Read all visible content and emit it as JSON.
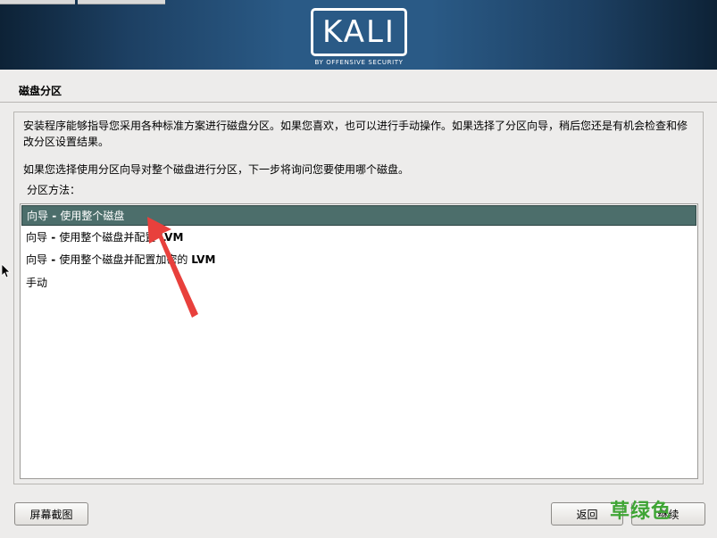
{
  "banner": {
    "logo_text": "KALI",
    "logo_subtext": "BY OFFENSIVE SECURITY"
  },
  "page": {
    "title": "磁盘分区",
    "description_line1": "安装程序能够指导您采用各种标准方案进行磁盘分区。如果您喜欢，也可以进行手动操作。如果选择了分区向导，稍后您还是有机会检查和修改分区设置结果。",
    "description_line2": "如果您选择使用分区向导对整个磁盘进行分区，下一步将询问您要使用哪个磁盘。",
    "method_label": "分区方法："
  },
  "methods": [
    {
      "prefix": "向导",
      "sep": " - ",
      "text": "使用整个磁盘",
      "suffix": "",
      "selected": true
    },
    {
      "prefix": "向导",
      "sep": " - ",
      "text": "使用整个磁盘并配置 ",
      "suffix": "LVM",
      "selected": false
    },
    {
      "prefix": "向导",
      "sep": " - ",
      "text": "使用整个磁盘并配置加密的 ",
      "suffix": "LVM",
      "selected": false
    },
    {
      "prefix": "手动",
      "sep": "",
      "text": "",
      "suffix": "",
      "selected": false
    }
  ],
  "buttons": {
    "screenshot": "屏幕截图",
    "back": "返回",
    "continue": "继续"
  },
  "watermark": "草绿色",
  "colors": {
    "selected_bg": "#4c6e6b",
    "arrow": "#e8403c",
    "watermark": "#3fa535"
  }
}
